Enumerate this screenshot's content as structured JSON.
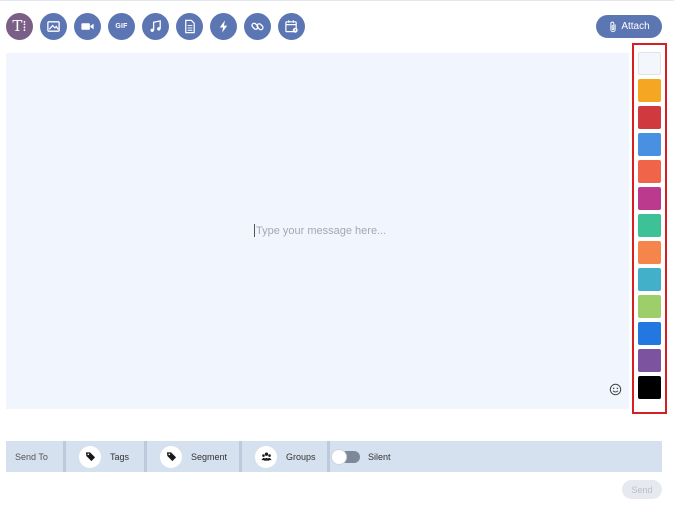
{
  "toolbar": {
    "tools": [
      {
        "name": "text-format",
        "icon": "text-format-icon"
      },
      {
        "name": "image",
        "icon": "image-icon"
      },
      {
        "name": "video",
        "icon": "video-icon"
      },
      {
        "name": "gif",
        "icon": "gif-icon",
        "label": "GIF"
      },
      {
        "name": "audio",
        "icon": "music-note-icon"
      },
      {
        "name": "document",
        "icon": "document-icon"
      },
      {
        "name": "flash",
        "icon": "lightning-icon"
      },
      {
        "name": "link",
        "icon": "link-icon"
      },
      {
        "name": "schedule",
        "icon": "calendar-icon"
      }
    ],
    "text_tool_glyph": "T⁞"
  },
  "attach": {
    "label": "Attach",
    "icon": "paperclip-icon"
  },
  "editor": {
    "placeholder": "Type your message here...",
    "emoji_icon": "smiley-icon"
  },
  "palette": {
    "colors": [
      "#f3f6fc",
      "#f5a623",
      "#d0393e",
      "#4a90e2",
      "#f0654a",
      "#bb3a8e",
      "#3fc197",
      "#f5854a",
      "#42b0c9",
      "#9ccf6a",
      "#2377e1",
      "#7c539f",
      "#000000"
    ],
    "highlight_color": "#d71f23"
  },
  "send_to": {
    "label": "Send To",
    "tags_label": "Tags",
    "segment_label": "Segment",
    "groups_label": "Groups",
    "silent_label": "Silent",
    "silent_on": false
  },
  "send": {
    "label": "Send",
    "disabled": true
  },
  "colors": {
    "accent": "#5b76b2",
    "text_tool": "#7a5f86",
    "editor_bg": "#f0f5fe",
    "bar_bg": "#d5e1ef"
  }
}
